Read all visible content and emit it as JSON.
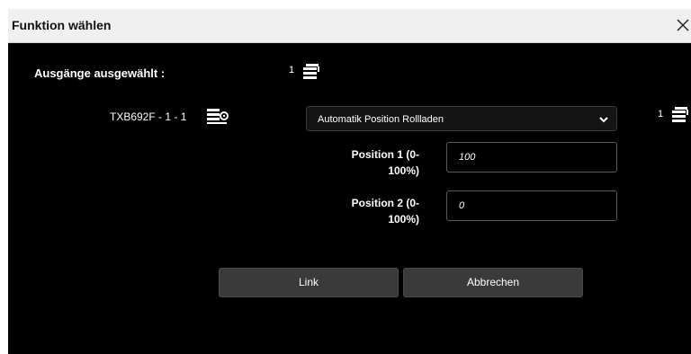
{
  "dialog": {
    "title": "Funktion wählen",
    "close_icon": "close-icon"
  },
  "outputs": {
    "label": "Ausgänge ausgewählt :",
    "count": "1",
    "icon": "stack-icon"
  },
  "device": {
    "name": "TXB692F - 1 - 1",
    "icon": "device-settings-icon"
  },
  "function_select": {
    "value": "Automatik Position Rollladen",
    "icon": "chevron-down-icon"
  },
  "right_count": "1",
  "fields": {
    "position1": {
      "label_line1": "Position 1 (0-",
      "label_line2": "100%)",
      "value": "100"
    },
    "position2": {
      "label_line1": "Position 2 (0-",
      "label_line2": "100%)",
      "value": "0"
    }
  },
  "buttons": {
    "link": "Link",
    "cancel": "Abbrechen"
  },
  "colors": {
    "background": "#000000",
    "titlebar": "#f0f0f0",
    "button": "#3a3a3a"
  }
}
